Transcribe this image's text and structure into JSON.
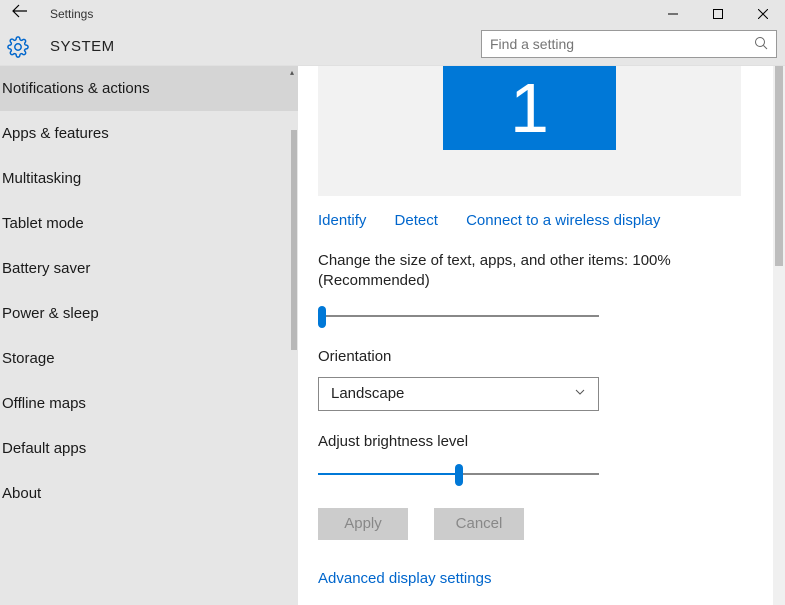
{
  "window": {
    "title": "Settings"
  },
  "header": {
    "section": "SYSTEM"
  },
  "search": {
    "placeholder": "Find a setting"
  },
  "sidebar": {
    "items": [
      {
        "label": "Notifications & actions",
        "selected": true
      },
      {
        "label": "Apps & features"
      },
      {
        "label": "Multitasking"
      },
      {
        "label": "Tablet mode"
      },
      {
        "label": "Battery saver"
      },
      {
        "label": "Power & sleep"
      },
      {
        "label": "Storage"
      },
      {
        "label": "Offline maps"
      },
      {
        "label": "Default apps"
      },
      {
        "label": "About"
      }
    ]
  },
  "display": {
    "monitor_number": "1",
    "links": {
      "identify": "Identify",
      "detect": "Detect",
      "wireless": "Connect to a wireless display"
    },
    "scale_label": "Change the size of text, apps, and other items: 100% (Recommended)",
    "scale_percent": 0,
    "orientation_label": "Orientation",
    "orientation_value": "Landscape",
    "brightness_label": "Adjust brightness level",
    "brightness_percent": 50,
    "apply_label": "Apply",
    "cancel_label": "Cancel",
    "advanced_label": "Advanced display settings"
  }
}
